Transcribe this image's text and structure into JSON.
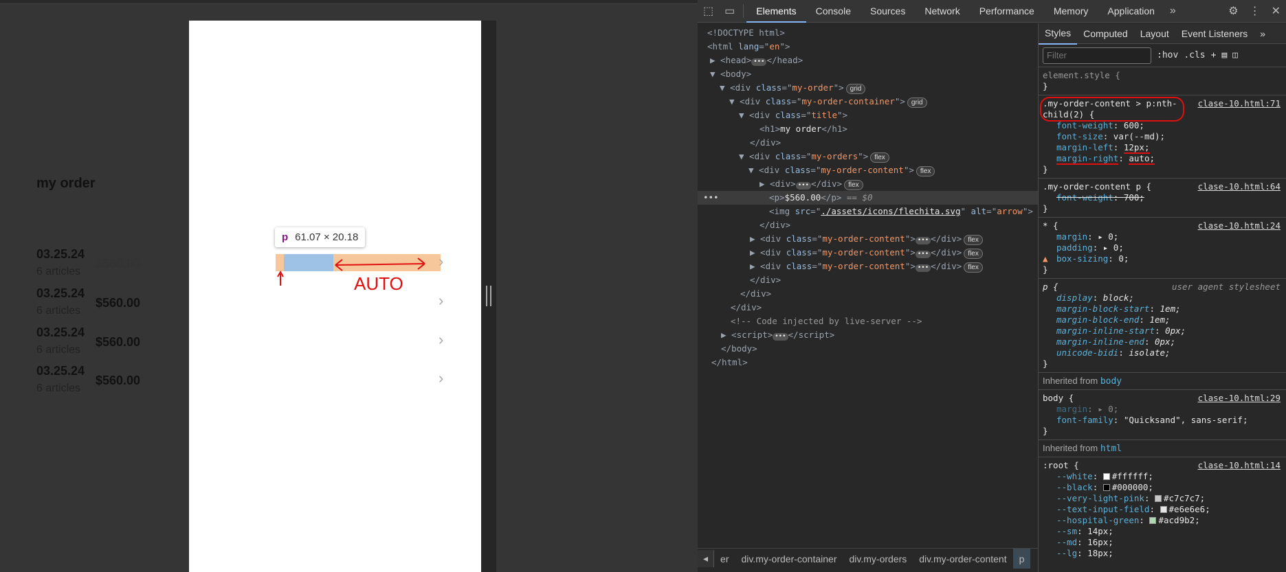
{
  "page": {
    "title": "my order",
    "orders": [
      {
        "date": "03.25.24",
        "articles": "6 articles",
        "price": "$560.00"
      },
      {
        "date": "03.25.24",
        "articles": "6 articles",
        "price": "$560.00"
      },
      {
        "date": "03.25.24",
        "articles": "6 articles",
        "price": "$560.00"
      },
      {
        "date": "03.25.24",
        "articles": "6 articles",
        "price": "$560.00"
      }
    ],
    "tooltip": {
      "tag": "p",
      "size": "61.07 × 20.18"
    },
    "annotation": "AUTO"
  },
  "devtools": {
    "tabs": [
      "Elements",
      "Console",
      "Sources",
      "Network",
      "Performance",
      "Memory",
      "Application"
    ],
    "subtabs": [
      "Styles",
      "Computed",
      "Layout",
      "Event Listeners"
    ],
    "filter_placeholder": "Filter",
    "hov": ":hov",
    "cls": ".cls",
    "dom": {
      "doctype": "<!DOCTYPE html>",
      "selected_text": "$560.00",
      "selected_marker": "== $0",
      "img_src": "./assets/icons/flechita.svg",
      "img_alt": "arrow",
      "comment": "<!-- Code injected by live-server -->",
      "h1_text": "my order"
    },
    "breadcrumbs": [
      "er",
      "div.my-order-container",
      "div.my-orders",
      "div.my-order-content",
      "p"
    ],
    "styles": {
      "element_style": "element.style {",
      "rule1": {
        "selector": ".my-order-content > p:nth-child(2) {",
        "selector_a": ".my-order-content > p:nth-",
        "selector_b": "child(2) {",
        "source": "clase-10.html:71",
        "props": [
          [
            "font-weight",
            "600;"
          ],
          [
            "font-size",
            "var(--md);"
          ],
          [
            "margin-left",
            "12px;"
          ],
          [
            "margin-right",
            "auto;"
          ]
        ]
      },
      "rule2": {
        "selector": ".my-order-content p {",
        "source": "clase-10.html:64",
        "props": [
          [
            "font-weight",
            "700;"
          ]
        ]
      },
      "rule3": {
        "selector": "* {",
        "source": "clase-10.html:24",
        "props": [
          [
            "margin",
            "▸ 0;"
          ],
          [
            "padding",
            "▸ 0;"
          ],
          [
            "box-sizing",
            "0;"
          ]
        ]
      },
      "rule4": {
        "selector": "p {",
        "source": "user agent stylesheet",
        "props": [
          [
            "display",
            "block;"
          ],
          [
            "margin-block-start",
            "1em;"
          ],
          [
            "margin-block-end",
            "1em;"
          ],
          [
            "margin-inline-start",
            "0px;"
          ],
          [
            "margin-inline-end",
            "0px;"
          ],
          [
            "unicode-bidi",
            "isolate;"
          ]
        ]
      },
      "inherited_body": "Inherited from",
      "body_tag": "body",
      "rule5": {
        "selector": "body {",
        "source": "clase-10.html:29",
        "props": [
          [
            "margin",
            "▸ 0;"
          ],
          [
            "font-family",
            "\"Quicksand\", sans-serif;"
          ]
        ]
      },
      "html_tag": "html",
      "rule6": {
        "selector": ":root {",
        "source": "clase-10.html:14",
        "props": [
          [
            "--white",
            "#ffffff;"
          ],
          [
            "--black",
            "#000000;"
          ],
          [
            "--very-light-pink",
            "#c7c7c7;"
          ],
          [
            "--text-input-field",
            "#e6e6e6;"
          ],
          [
            "--hospital-green",
            "#acd9b2;"
          ],
          [
            "--sm",
            "14px;"
          ],
          [
            "--md",
            "16px;"
          ],
          [
            "--lg",
            "18px;"
          ]
        ],
        "swatches": [
          "#ffffff",
          "#000000",
          "#c7c7c7",
          "#e6e6e6",
          "#acd9b2"
        ]
      }
    }
  }
}
